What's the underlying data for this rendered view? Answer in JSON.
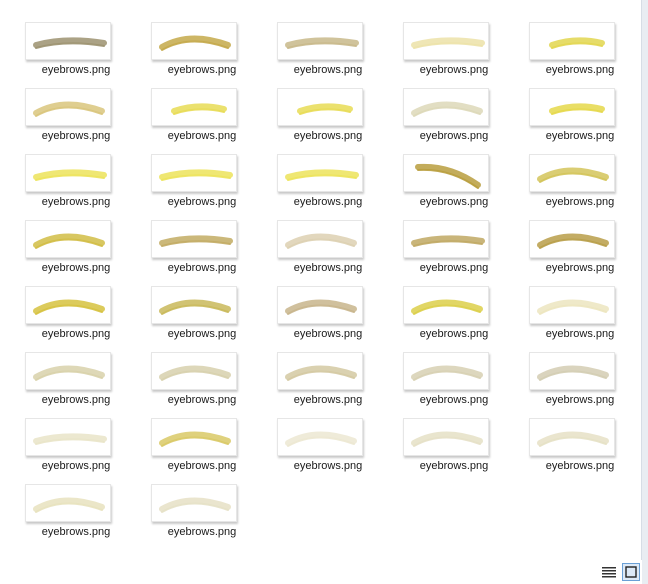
{
  "files": [
    {
      "name": "eyebrows.png",
      "color": "#9c9270",
      "shape": "flat"
    },
    {
      "name": "eyebrows.png",
      "color": "#c4a94a",
      "shape": "arch"
    },
    {
      "name": "eyebrows.png",
      "color": "#c8b88a",
      "shape": "flat"
    },
    {
      "name": "eyebrows.png",
      "color": "#ece2a8",
      "shape": "flat"
    },
    {
      "name": "eyebrows.png",
      "color": "#e2d64f",
      "shape": "short"
    },
    {
      "name": "eyebrows.png",
      "color": "#d9c57c",
      "shape": "arch"
    },
    {
      "name": "eyebrows.png",
      "color": "#e8dc55",
      "shape": "short"
    },
    {
      "name": "eyebrows.png",
      "color": "#e8dc55",
      "shape": "short"
    },
    {
      "name": "eyebrows.png",
      "color": "#ddd8b8",
      "shape": "arch"
    },
    {
      "name": "eyebrows.png",
      "color": "#e5d84a",
      "shape": "short"
    },
    {
      "name": "eyebrows.png",
      "color": "#ece35a",
      "shape": "flat"
    },
    {
      "name": "eyebrows.png",
      "color": "#ece35a",
      "shape": "flat"
    },
    {
      "name": "eyebrows.png",
      "color": "#ece35a",
      "shape": "flat"
    },
    {
      "name": "eyebrows.png",
      "color": "#b99e3e",
      "shape": "steep"
    },
    {
      "name": "eyebrows.png",
      "color": "#d3c45a",
      "shape": "arch"
    },
    {
      "name": "eyebrows.png",
      "color": "#d1bd45",
      "shape": "arch"
    },
    {
      "name": "eyebrows.png",
      "color": "#c2ab63",
      "shape": "flat"
    },
    {
      "name": "eyebrows.png",
      "color": "#ddd0b1",
      "shape": "arch"
    },
    {
      "name": "eyebrows.png",
      "color": "#c0a863",
      "shape": "flat"
    },
    {
      "name": "eyebrows.png",
      "color": "#b89e49",
      "shape": "arch"
    },
    {
      "name": "eyebrows.png",
      "color": "#d6c240",
      "shape": "arch"
    },
    {
      "name": "eyebrows.png",
      "color": "#c9b95a",
      "shape": "arch"
    },
    {
      "name": "eyebrows.png",
      "color": "#c8b58c",
      "shape": "arch"
    },
    {
      "name": "eyebrows.png",
      "color": "#dccf4a",
      "shape": "arch"
    },
    {
      "name": "eyebrows.png",
      "color": "#ece5bf",
      "shape": "arch"
    },
    {
      "name": "eyebrows.png",
      "color": "#d8d1aa",
      "shape": "arch"
    },
    {
      "name": "eyebrows.png",
      "color": "#d7d0ad",
      "shape": "arch"
    },
    {
      "name": "eyebrows.png",
      "color": "#d4c9a2",
      "shape": "arch"
    },
    {
      "name": "eyebrows.png",
      "color": "#d7d0b3",
      "shape": "arch"
    },
    {
      "name": "eyebrows.png",
      "color": "#d3cdb3",
      "shape": "arch"
    },
    {
      "name": "eyebrows.png",
      "color": "#e9e4c8",
      "shape": "flat"
    },
    {
      "name": "eyebrows.png",
      "color": "#d9c966",
      "shape": "arch"
    },
    {
      "name": "eyebrows.png",
      "color": "#ece8d2",
      "shape": "arch"
    },
    {
      "name": "eyebrows.png",
      "color": "#e5e0c6",
      "shape": "arch"
    },
    {
      "name": "eyebrows.png",
      "color": "#e6e1c5",
      "shape": "arch"
    },
    {
      "name": "eyebrows.png",
      "color": "#e8e2be",
      "shape": "arch"
    },
    {
      "name": "eyebrows.png",
      "color": "#e6e1c6",
      "shape": "arch"
    }
  ],
  "statusbar": {
    "details_view_icon": "details-view-icon",
    "tiles_view_icon": "large-icons-view-icon"
  }
}
